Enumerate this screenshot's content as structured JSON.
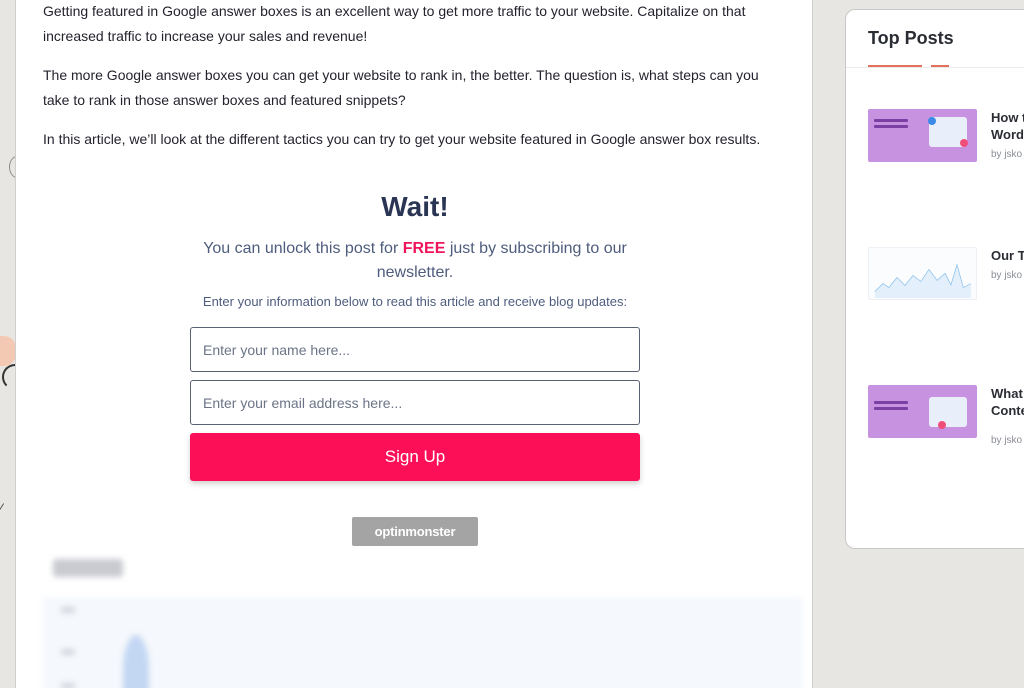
{
  "article": {
    "paragraphs": [
      "Getting featured in Google answer boxes is an excellent way to get more traffic to your website. Capitalize on that increased traffic to increase your sales and revenue!",
      "The more Google answer boxes you can get your website to rank in, the better. The question is, what steps can you take to rank in those answer boxes and featured snippets?",
      "In this article, we’ll look at the different tactics you can try to get your website featured in Google answer box results."
    ]
  },
  "optin": {
    "title": "Wait!",
    "unlock_before": "You can unlock this post for ",
    "unlock_free": "FREE",
    "unlock_after": " just by subscribing to our newsletter.",
    "instruction": "Enter your information below to read this article and receive blog updates:",
    "name_placeholder": "Enter your name here...",
    "email_placeholder": "Enter your email address here...",
    "signup_label": "Sign Up",
    "badge": "optinmonster",
    "accent_color": "#fc0f57"
  },
  "sidebar": {
    "title": "Top Posts",
    "posts": [
      {
        "title_line1": "How t",
        "title_line2": "Word",
        "byline": "by jsko",
        "thumb": "purple"
      },
      {
        "title_line1": "Our T",
        "title_line2": "",
        "byline": "by jsko",
        "thumb": "chart"
      },
      {
        "title_line1": "What",
        "title_line2": "Conte",
        "byline": "by jsko",
        "thumb": "purple"
      }
    ]
  }
}
